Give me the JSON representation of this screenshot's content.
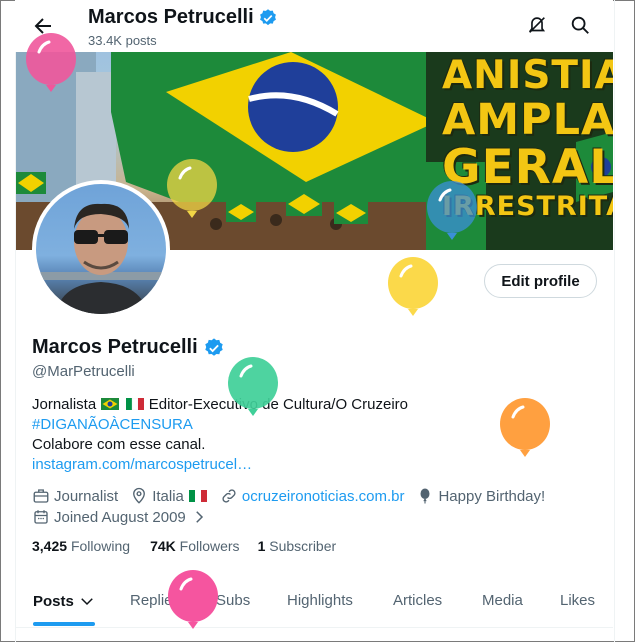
{
  "header": {
    "name": "Marcos Petrucelli",
    "posts_count": "33.4K posts"
  },
  "banner": {
    "lines": [
      "ANISTIA",
      "AMPLA",
      "GERAL",
      "IRRESTRITA"
    ]
  },
  "profile": {
    "name": "Marcos Petrucelli",
    "handle": "@MarPetrucelli",
    "edit_button": "Edit profile",
    "bio": {
      "line1_prefix": "Jornalista",
      "line1_suffix": "Editor-Executivo de Cultura/O Cruzeiro",
      "hashtag": "#DIGANÃOÀCENSURA",
      "line3": "Colabore com esse canal.",
      "link": "instagram.com/marcospetrucel…"
    },
    "meta": {
      "job": "Journalist",
      "location": "Italia",
      "website": "ocruzeironoticias.com.br",
      "birthday": "Happy Birthday!",
      "joined": "Joined August 2009"
    },
    "stats": {
      "following_count": "3,425",
      "following_label": "Following",
      "followers_count": "74K",
      "followers_label": "Followers",
      "subscriber_count": "1",
      "subscriber_label": "Subscriber"
    }
  },
  "tabs": [
    "Posts",
    "Replies",
    "Subs",
    "Highlights",
    "Articles",
    "Media",
    "Likes"
  ],
  "colors": {
    "accent": "#1d9bf0",
    "text": "#0f1419",
    "muted": "#536471"
  }
}
